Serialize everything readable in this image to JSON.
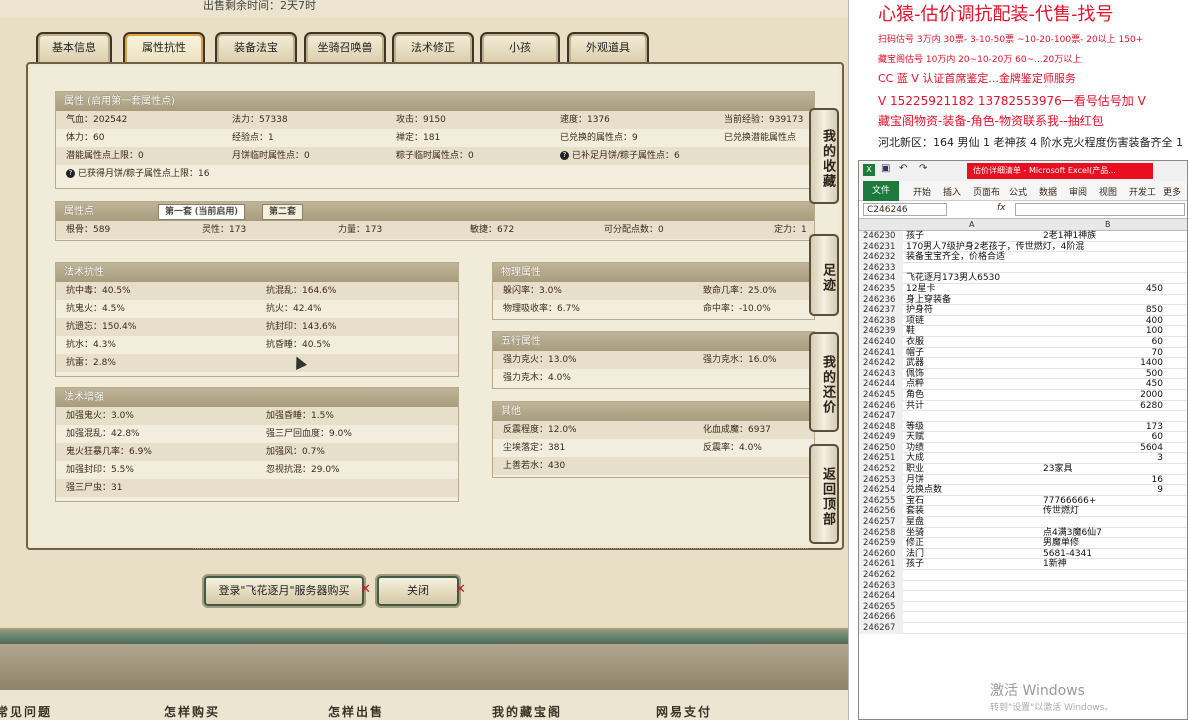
{
  "top": {
    "sale_time": "出售剩余时间：2天7时"
  },
  "tabs": [
    "基本信息",
    "属性抗性",
    "装备法宝",
    "坐骑召唤兽",
    "法术修正",
    "小孩",
    "外观道具"
  ],
  "attr_panel": {
    "title": "属性 (启用第一套属性点)",
    "rows": [
      [
        "气血：202542",
        "法力：57338",
        "攻击：9150",
        "速度：1376",
        "当前经验：939173"
      ],
      [
        "体力：60",
        "经验点：1",
        "禅定：181",
        "已兑换的属性点：9",
        "已兑换潜能属性点"
      ],
      [
        "潜能属性点上限：0",
        "月饼临时属性点：0",
        "粽子临时属性点：0",
        "已补足月饼/粽子属性点：6",
        ""
      ]
    ],
    "note": "已获得月饼/粽子属性点上限：16"
  },
  "points_panel": {
    "title": "属性点",
    "tab1": "第一套 (当前启用)",
    "tab2": "第二套",
    "row": [
      "根骨：589",
      "灵性：173",
      "力量：173",
      "敏捷：672",
      "可分配点数：0",
      "定力：1"
    ]
  },
  "resist": {
    "title": "法术抗性",
    "rows": [
      [
        "抗中毒：40.5%",
        "抗混乱：164.6%"
      ],
      [
        "抗鬼火：4.5%",
        "抗火：42.4%"
      ],
      [
        "抗遗忘：150.4%",
        "抗封印：143.6%"
      ],
      [
        "抗水：4.3%",
        "抗昏睡：40.5%"
      ],
      [
        "抗雷：2.8%",
        ""
      ]
    ]
  },
  "enhance": {
    "title": "法术增强",
    "rows": [
      [
        "加强鬼火：3.0%",
        "加强昏睡：1.5%"
      ],
      [
        "加强混乱：42.8%",
        "强三尸回血度：9.0%"
      ],
      [
        "鬼火狂暴几率：6.9%",
        "加强风：0.7%"
      ],
      [
        "加强封印：5.5%",
        "忽视抗混：29.0%"
      ],
      [
        "强三尸虫：31",
        ""
      ]
    ]
  },
  "physical": {
    "title": "物理属性",
    "rows": [
      [
        "躲闪率：3.0%",
        "致命几率：25.0%"
      ],
      [
        "物理吸收率：6.7%",
        "命中率：-10.0%"
      ]
    ]
  },
  "five": {
    "title": "五行属性",
    "rows": [
      [
        "强力克火：13.0%",
        "强力克水：16.0%"
      ],
      [
        "强力克木：4.0%",
        ""
      ]
    ]
  },
  "other": {
    "title": "其他",
    "rows": [
      [
        "反震程度：12.0%",
        "化血成魔：6937"
      ],
      [
        "尘埃落定：381",
        "反震率：4.0%"
      ],
      [
        "上善若水：430",
        ""
      ]
    ]
  },
  "side_buttons": [
    "我的收藏",
    "足迹",
    "我的还价",
    "返回顶部"
  ],
  "buttons": {
    "login": "登录\"飞花逐月\"服务器购买",
    "close": "关闭"
  },
  "footer": [
    "常见问题",
    "怎样购买",
    "怎样出售",
    "我的藏宝阁",
    "网易支付"
  ],
  "ad": {
    "title": "心猿-估价调抗配装-代售-找号",
    "lines": [
      "扫码估号 3万内 30票- 3-10-50票 ~10-20-100票- 20以上 150+",
      "藏宝阁估号 10万内 20~10-20万 60~...20万以上",
      "CC 蓝 V 认证首席鉴定...金牌鉴定师服务",
      "V 15225921182      13782553976一看号估号加 V",
      "藏宝阁物资-装备-角色-物资联系我--抽红包",
      "河北新区：164 男仙 1 老神孩 4 阶水克火程度伤害装备齐全 1"
    ]
  },
  "excel": {
    "title": "估价详细清单 - Microsoft Excel(产品...",
    "ribbon": [
      "文件",
      "开始",
      "插入",
      "页面布",
      "公式",
      "数据",
      "审阅",
      "视图",
      "开发工",
      "更多"
    ],
    "cell_ref": "C246246",
    "fx": "fx",
    "col_a": "A",
    "col_b": "B",
    "rows": [
      [
        "246230",
        "孩子",
        "2老1神1神族",
        ""
      ],
      [
        "246231",
        "170男人7级护身2老孩子，传世燃灯，4阶混",
        "",
        ""
      ],
      [
        "246232",
        "装备宝宝齐全，价格合适",
        "",
        ""
      ],
      [
        "246233",
        "",
        "",
        ""
      ],
      [
        "246234",
        "飞花逐月173男人6530",
        "",
        ""
      ],
      [
        "246235",
        "12星卡",
        "",
        "450"
      ],
      [
        "246236",
        "身上穿装备",
        "",
        ""
      ],
      [
        "246237",
        "护身符",
        "",
        "850"
      ],
      [
        "246238",
        "项链",
        "",
        "400"
      ],
      [
        "246239",
        "鞋",
        "",
        "100"
      ],
      [
        "246240",
        "衣服",
        "",
        "60"
      ],
      [
        "246241",
        "帽子",
        "",
        "70"
      ],
      [
        "246242",
        "武器",
        "",
        "1400"
      ],
      [
        "246243",
        "佩饰",
        "",
        "500"
      ],
      [
        "246244",
        "点粹",
        "",
        "450"
      ],
      [
        "246245",
        "角色",
        "",
        "2000"
      ],
      [
        "246246",
        "共计",
        "",
        "6280"
      ],
      [
        "246247",
        "",
        "",
        ""
      ],
      [
        "246248",
        "等级",
        "",
        "173"
      ],
      [
        "246249",
        "天赋",
        "",
        "60"
      ],
      [
        "246250",
        "功绩",
        "",
        "5604"
      ],
      [
        "246251",
        "大成",
        "",
        "3"
      ],
      [
        "246252",
        "职业",
        "23家具",
        ""
      ],
      [
        "246253",
        "月饼",
        "",
        "16"
      ],
      [
        "246254",
        "兑换点数",
        "",
        "9"
      ],
      [
        "246255",
        "宝石",
        "77766666+",
        ""
      ],
      [
        "246256",
        "套装",
        "传世燃灯",
        ""
      ],
      [
        "246257",
        "星盘",
        "",
        ""
      ],
      [
        "246258",
        "坐骑",
        "点4满3魔6仙7",
        ""
      ],
      [
        "246259",
        "修正",
        "男魔单修",
        ""
      ],
      [
        "246260",
        "法门",
        "5681-4341",
        ""
      ],
      [
        "246261",
        "孩子",
        "1新神",
        ""
      ],
      [
        "246262",
        "",
        "",
        ""
      ],
      [
        "246263",
        "",
        "",
        ""
      ],
      [
        "246264",
        "",
        "",
        ""
      ],
      [
        "246265",
        "",
        "",
        ""
      ],
      [
        "246266",
        "",
        "",
        ""
      ],
      [
        "246267",
        "",
        "",
        ""
      ]
    ]
  },
  "watermark": {
    "line1": "激活 Windows",
    "line2": "转到\"设置\"以激活 Windows。"
  },
  "colors": {
    "ad_red": "#e8102a",
    "excel_green": "#1e7a3c",
    "panel_header": "#a89c7f"
  }
}
